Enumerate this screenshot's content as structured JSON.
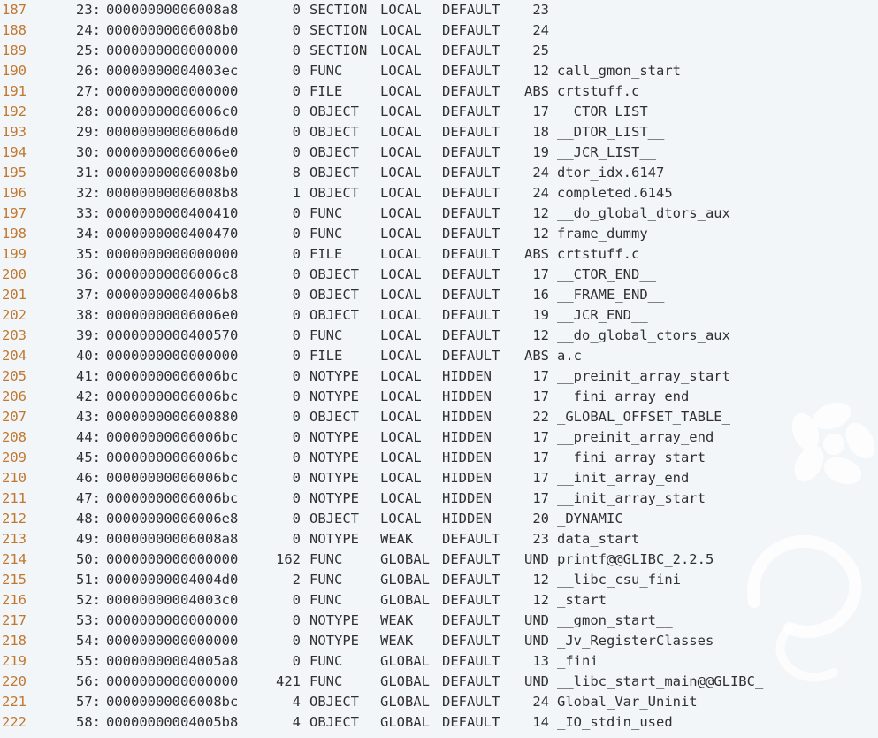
{
  "rows": [
    {
      "line": "187",
      "num": "23:",
      "addr": "00000000006008a8",
      "size": "0",
      "type": "SECTION",
      "bind": "LOCAL",
      "vis": "DEFAULT",
      "ndx": "23",
      "name": ""
    },
    {
      "line": "188",
      "num": "24:",
      "addr": "00000000006008b0",
      "size": "0",
      "type": "SECTION",
      "bind": "LOCAL",
      "vis": "DEFAULT",
      "ndx": "24",
      "name": ""
    },
    {
      "line": "189",
      "num": "25:",
      "addr": "0000000000000000",
      "size": "0",
      "type": "SECTION",
      "bind": "LOCAL",
      "vis": "DEFAULT",
      "ndx": "25",
      "name": ""
    },
    {
      "line": "190",
      "num": "26:",
      "addr": "00000000004003ec",
      "size": "0",
      "type": "FUNC",
      "bind": "LOCAL",
      "vis": "DEFAULT",
      "ndx": "12",
      "name": "call_gmon_start"
    },
    {
      "line": "191",
      "num": "27:",
      "addr": "0000000000000000",
      "size": "0",
      "type": "FILE",
      "bind": "LOCAL",
      "vis": "DEFAULT",
      "ndx": "ABS",
      "name": "crtstuff.c"
    },
    {
      "line": "192",
      "num": "28:",
      "addr": "00000000006006c0",
      "size": "0",
      "type": "OBJECT",
      "bind": "LOCAL",
      "vis": "DEFAULT",
      "ndx": "17",
      "name": "__CTOR_LIST__"
    },
    {
      "line": "193",
      "num": "29:",
      "addr": "00000000006006d0",
      "size": "0",
      "type": "OBJECT",
      "bind": "LOCAL",
      "vis": "DEFAULT",
      "ndx": "18",
      "name": "__DTOR_LIST__"
    },
    {
      "line": "194",
      "num": "30:",
      "addr": "00000000006006e0",
      "size": "0",
      "type": "OBJECT",
      "bind": "LOCAL",
      "vis": "DEFAULT",
      "ndx": "19",
      "name": "__JCR_LIST__"
    },
    {
      "line": "195",
      "num": "31:",
      "addr": "00000000006008b0",
      "size": "8",
      "type": "OBJECT",
      "bind": "LOCAL",
      "vis": "DEFAULT",
      "ndx": "24",
      "name": "dtor_idx.6147"
    },
    {
      "line": "196",
      "num": "32:",
      "addr": "00000000006008b8",
      "size": "1",
      "type": "OBJECT",
      "bind": "LOCAL",
      "vis": "DEFAULT",
      "ndx": "24",
      "name": "completed.6145"
    },
    {
      "line": "197",
      "num": "33:",
      "addr": "0000000000400410",
      "size": "0",
      "type": "FUNC",
      "bind": "LOCAL",
      "vis": "DEFAULT",
      "ndx": "12",
      "name": "__do_global_dtors_aux"
    },
    {
      "line": "198",
      "num": "34:",
      "addr": "0000000000400470",
      "size": "0",
      "type": "FUNC",
      "bind": "LOCAL",
      "vis": "DEFAULT",
      "ndx": "12",
      "name": "frame_dummy"
    },
    {
      "line": "199",
      "num": "35:",
      "addr": "0000000000000000",
      "size": "0",
      "type": "FILE",
      "bind": "LOCAL",
      "vis": "DEFAULT",
      "ndx": "ABS",
      "name": "crtstuff.c"
    },
    {
      "line": "200",
      "num": "36:",
      "addr": "00000000006006c8",
      "size": "0",
      "type": "OBJECT",
      "bind": "LOCAL",
      "vis": "DEFAULT",
      "ndx": "17",
      "name": "__CTOR_END__"
    },
    {
      "line": "201",
      "num": "37:",
      "addr": "00000000004006b8",
      "size": "0",
      "type": "OBJECT",
      "bind": "LOCAL",
      "vis": "DEFAULT",
      "ndx": "16",
      "name": "__FRAME_END__"
    },
    {
      "line": "202",
      "num": "38:",
      "addr": "00000000006006e0",
      "size": "0",
      "type": "OBJECT",
      "bind": "LOCAL",
      "vis": "DEFAULT",
      "ndx": "19",
      "name": "__JCR_END__"
    },
    {
      "line": "203",
      "num": "39:",
      "addr": "0000000000400570",
      "size": "0",
      "type": "FUNC",
      "bind": "LOCAL",
      "vis": "DEFAULT",
      "ndx": "12",
      "name": "__do_global_ctors_aux"
    },
    {
      "line": "204",
      "num": "40:",
      "addr": "0000000000000000",
      "size": "0",
      "type": "FILE",
      "bind": "LOCAL",
      "vis": "DEFAULT",
      "ndx": "ABS",
      "name": "a.c"
    },
    {
      "line": "205",
      "num": "41:",
      "addr": "00000000006006bc",
      "size": "0",
      "type": "NOTYPE",
      "bind": "LOCAL",
      "vis": "HIDDEN",
      "ndx": "17",
      "name": "__preinit_array_start"
    },
    {
      "line": "206",
      "num": "42:",
      "addr": "00000000006006bc",
      "size": "0",
      "type": "NOTYPE",
      "bind": "LOCAL",
      "vis": "HIDDEN",
      "ndx": "17",
      "name": "__fini_array_end"
    },
    {
      "line": "207",
      "num": "43:",
      "addr": "0000000000600880",
      "size": "0",
      "type": "OBJECT",
      "bind": "LOCAL",
      "vis": "HIDDEN",
      "ndx": "22",
      "name": "_GLOBAL_OFFSET_TABLE_"
    },
    {
      "line": "208",
      "num": "44:",
      "addr": "00000000006006bc",
      "size": "0",
      "type": "NOTYPE",
      "bind": "LOCAL",
      "vis": "HIDDEN",
      "ndx": "17",
      "name": "__preinit_array_end"
    },
    {
      "line": "209",
      "num": "45:",
      "addr": "00000000006006bc",
      "size": "0",
      "type": "NOTYPE",
      "bind": "LOCAL",
      "vis": "HIDDEN",
      "ndx": "17",
      "name": "__fini_array_start"
    },
    {
      "line": "210",
      "num": "46:",
      "addr": "00000000006006bc",
      "size": "0",
      "type": "NOTYPE",
      "bind": "LOCAL",
      "vis": "HIDDEN",
      "ndx": "17",
      "name": "__init_array_end"
    },
    {
      "line": "211",
      "num": "47:",
      "addr": "00000000006006bc",
      "size": "0",
      "type": "NOTYPE",
      "bind": "LOCAL",
      "vis": "HIDDEN",
      "ndx": "17",
      "name": "__init_array_start"
    },
    {
      "line": "212",
      "num": "48:",
      "addr": "00000000006006e8",
      "size": "0",
      "type": "OBJECT",
      "bind": "LOCAL",
      "vis": "HIDDEN",
      "ndx": "20",
      "name": "_DYNAMIC"
    },
    {
      "line": "213",
      "num": "49:",
      "addr": "00000000006008a8",
      "size": "0",
      "type": "NOTYPE",
      "bind": "WEAK",
      "vis": "DEFAULT",
      "ndx": "23",
      "name": "data_start"
    },
    {
      "line": "214",
      "num": "50:",
      "addr": "0000000000000000",
      "size": "162",
      "type": "FUNC",
      "bind": "GLOBAL",
      "vis": "DEFAULT",
      "ndx": "UND",
      "name": "printf@@GLIBC_2.2.5"
    },
    {
      "line": "215",
      "num": "51:",
      "addr": "00000000004004d0",
      "size": "2",
      "type": "FUNC",
      "bind": "GLOBAL",
      "vis": "DEFAULT",
      "ndx": "12",
      "name": "__libc_csu_fini"
    },
    {
      "line": "216",
      "num": "52:",
      "addr": "00000000004003c0",
      "size": "0",
      "type": "FUNC",
      "bind": "GLOBAL",
      "vis": "DEFAULT",
      "ndx": "12",
      "name": "_start"
    },
    {
      "line": "217",
      "num": "53:",
      "addr": "0000000000000000",
      "size": "0",
      "type": "NOTYPE",
      "bind": "WEAK",
      "vis": "DEFAULT",
      "ndx": "UND",
      "name": "__gmon_start__"
    },
    {
      "line": "218",
      "num": "54:",
      "addr": "0000000000000000",
      "size": "0",
      "type": "NOTYPE",
      "bind": "WEAK",
      "vis": "DEFAULT",
      "ndx": "UND",
      "name": "_Jv_RegisterClasses"
    },
    {
      "line": "219",
      "num": "55:",
      "addr": "00000000004005a8",
      "size": "0",
      "type": "FUNC",
      "bind": "GLOBAL",
      "vis": "DEFAULT",
      "ndx": "13",
      "name": "_fini"
    },
    {
      "line": "220",
      "num": "56:",
      "addr": "0000000000000000",
      "size": "421",
      "type": "FUNC",
      "bind": "GLOBAL",
      "vis": "DEFAULT",
      "ndx": "UND",
      "name": "__libc_start_main@@GLIBC_"
    },
    {
      "line": "221",
      "num": "57:",
      "addr": "00000000006008bc",
      "size": "4",
      "type": "OBJECT",
      "bind": "GLOBAL",
      "vis": "DEFAULT",
      "ndx": "24",
      "name": "Global_Var_Uninit"
    },
    {
      "line": "222",
      "num": "58:",
      "addr": "00000000004005b8",
      "size": "4",
      "type": "OBJECT",
      "bind": "GLOBAL",
      "vis": "DEFAULT",
      "ndx": "14",
      "name": "_IO_stdin_used"
    }
  ],
  "colors": {
    "line_number": "#c07830",
    "text": "#303030",
    "background": "#f3f6f9"
  }
}
